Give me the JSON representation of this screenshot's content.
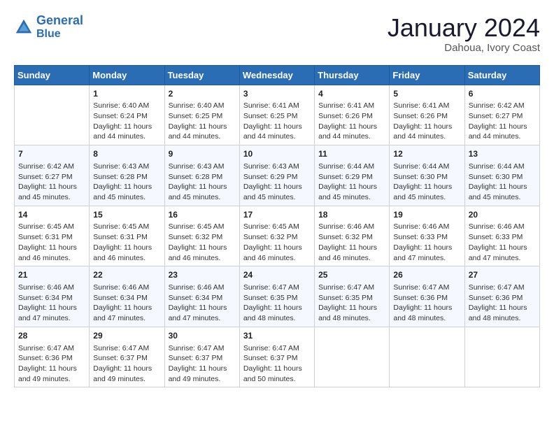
{
  "header": {
    "logo_line1": "General",
    "logo_line2": "Blue",
    "month": "January 2024",
    "location": "Dahoua, Ivory Coast"
  },
  "weekdays": [
    "Sunday",
    "Monday",
    "Tuesday",
    "Wednesday",
    "Thursday",
    "Friday",
    "Saturday"
  ],
  "weeks": [
    [
      {
        "day": "",
        "sunrise": "",
        "sunset": "",
        "daylight": ""
      },
      {
        "day": "1",
        "sunrise": "Sunrise: 6:40 AM",
        "sunset": "Sunset: 6:24 PM",
        "daylight": "Daylight: 11 hours and 44 minutes."
      },
      {
        "day": "2",
        "sunrise": "Sunrise: 6:40 AM",
        "sunset": "Sunset: 6:25 PM",
        "daylight": "Daylight: 11 hours and 44 minutes."
      },
      {
        "day": "3",
        "sunrise": "Sunrise: 6:41 AM",
        "sunset": "Sunset: 6:25 PM",
        "daylight": "Daylight: 11 hours and 44 minutes."
      },
      {
        "day": "4",
        "sunrise": "Sunrise: 6:41 AM",
        "sunset": "Sunset: 6:26 PM",
        "daylight": "Daylight: 11 hours and 44 minutes."
      },
      {
        "day": "5",
        "sunrise": "Sunrise: 6:41 AM",
        "sunset": "Sunset: 6:26 PM",
        "daylight": "Daylight: 11 hours and 44 minutes."
      },
      {
        "day": "6",
        "sunrise": "Sunrise: 6:42 AM",
        "sunset": "Sunset: 6:27 PM",
        "daylight": "Daylight: 11 hours and 44 minutes."
      }
    ],
    [
      {
        "day": "7",
        "sunrise": "Sunrise: 6:42 AM",
        "sunset": "Sunset: 6:27 PM",
        "daylight": "Daylight: 11 hours and 45 minutes."
      },
      {
        "day": "8",
        "sunrise": "Sunrise: 6:43 AM",
        "sunset": "Sunset: 6:28 PM",
        "daylight": "Daylight: 11 hours and 45 minutes."
      },
      {
        "day": "9",
        "sunrise": "Sunrise: 6:43 AM",
        "sunset": "Sunset: 6:28 PM",
        "daylight": "Daylight: 11 hours and 45 minutes."
      },
      {
        "day": "10",
        "sunrise": "Sunrise: 6:43 AM",
        "sunset": "Sunset: 6:29 PM",
        "daylight": "Daylight: 11 hours and 45 minutes."
      },
      {
        "day": "11",
        "sunrise": "Sunrise: 6:44 AM",
        "sunset": "Sunset: 6:29 PM",
        "daylight": "Daylight: 11 hours and 45 minutes."
      },
      {
        "day": "12",
        "sunrise": "Sunrise: 6:44 AM",
        "sunset": "Sunset: 6:30 PM",
        "daylight": "Daylight: 11 hours and 45 minutes."
      },
      {
        "day": "13",
        "sunrise": "Sunrise: 6:44 AM",
        "sunset": "Sunset: 6:30 PM",
        "daylight": "Daylight: 11 hours and 45 minutes."
      }
    ],
    [
      {
        "day": "14",
        "sunrise": "Sunrise: 6:45 AM",
        "sunset": "Sunset: 6:31 PM",
        "daylight": "Daylight: 11 hours and 46 minutes."
      },
      {
        "day": "15",
        "sunrise": "Sunrise: 6:45 AM",
        "sunset": "Sunset: 6:31 PM",
        "daylight": "Daylight: 11 hours and 46 minutes."
      },
      {
        "day": "16",
        "sunrise": "Sunrise: 6:45 AM",
        "sunset": "Sunset: 6:32 PM",
        "daylight": "Daylight: 11 hours and 46 minutes."
      },
      {
        "day": "17",
        "sunrise": "Sunrise: 6:45 AM",
        "sunset": "Sunset: 6:32 PM",
        "daylight": "Daylight: 11 hours and 46 minutes."
      },
      {
        "day": "18",
        "sunrise": "Sunrise: 6:46 AM",
        "sunset": "Sunset: 6:32 PM",
        "daylight": "Daylight: 11 hours and 46 minutes."
      },
      {
        "day": "19",
        "sunrise": "Sunrise: 6:46 AM",
        "sunset": "Sunset: 6:33 PM",
        "daylight": "Daylight: 11 hours and 47 minutes."
      },
      {
        "day": "20",
        "sunrise": "Sunrise: 6:46 AM",
        "sunset": "Sunset: 6:33 PM",
        "daylight": "Daylight: 11 hours and 47 minutes."
      }
    ],
    [
      {
        "day": "21",
        "sunrise": "Sunrise: 6:46 AM",
        "sunset": "Sunset: 6:34 PM",
        "daylight": "Daylight: 11 hours and 47 minutes."
      },
      {
        "day": "22",
        "sunrise": "Sunrise: 6:46 AM",
        "sunset": "Sunset: 6:34 PM",
        "daylight": "Daylight: 11 hours and 47 minutes."
      },
      {
        "day": "23",
        "sunrise": "Sunrise: 6:46 AM",
        "sunset": "Sunset: 6:34 PM",
        "daylight": "Daylight: 11 hours and 47 minutes."
      },
      {
        "day": "24",
        "sunrise": "Sunrise: 6:47 AM",
        "sunset": "Sunset: 6:35 PM",
        "daylight": "Daylight: 11 hours and 48 minutes."
      },
      {
        "day": "25",
        "sunrise": "Sunrise: 6:47 AM",
        "sunset": "Sunset: 6:35 PM",
        "daylight": "Daylight: 11 hours and 48 minutes."
      },
      {
        "day": "26",
        "sunrise": "Sunrise: 6:47 AM",
        "sunset": "Sunset: 6:36 PM",
        "daylight": "Daylight: 11 hours and 48 minutes."
      },
      {
        "day": "27",
        "sunrise": "Sunrise: 6:47 AM",
        "sunset": "Sunset: 6:36 PM",
        "daylight": "Daylight: 11 hours and 48 minutes."
      }
    ],
    [
      {
        "day": "28",
        "sunrise": "Sunrise: 6:47 AM",
        "sunset": "Sunset: 6:36 PM",
        "daylight": "Daylight: 11 hours and 49 minutes."
      },
      {
        "day": "29",
        "sunrise": "Sunrise: 6:47 AM",
        "sunset": "Sunset: 6:37 PM",
        "daylight": "Daylight: 11 hours and 49 minutes."
      },
      {
        "day": "30",
        "sunrise": "Sunrise: 6:47 AM",
        "sunset": "Sunset: 6:37 PM",
        "daylight": "Daylight: 11 hours and 49 minutes."
      },
      {
        "day": "31",
        "sunrise": "Sunrise: 6:47 AM",
        "sunset": "Sunset: 6:37 PM",
        "daylight": "Daylight: 11 hours and 50 minutes."
      },
      {
        "day": "",
        "sunrise": "",
        "sunset": "",
        "daylight": ""
      },
      {
        "day": "",
        "sunrise": "",
        "sunset": "",
        "daylight": ""
      },
      {
        "day": "",
        "sunrise": "",
        "sunset": "",
        "daylight": ""
      }
    ]
  ]
}
